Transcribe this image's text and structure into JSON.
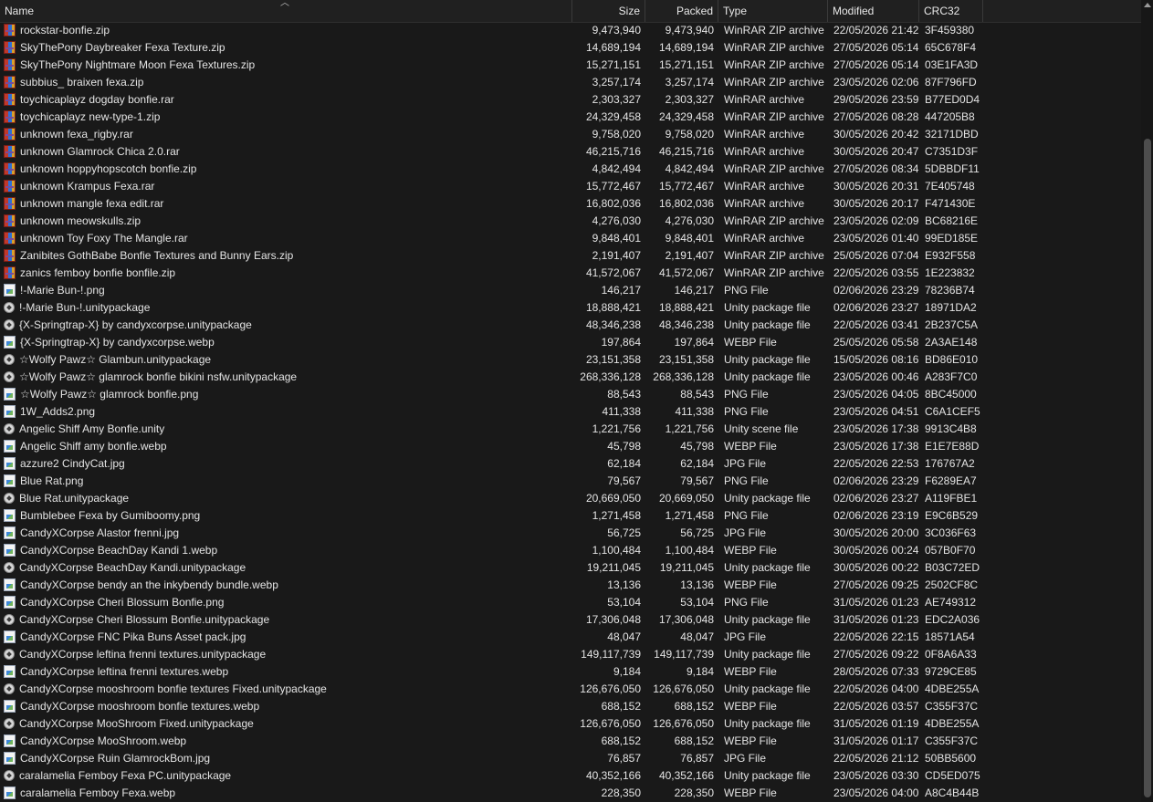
{
  "columns": {
    "name": "Name",
    "size": "Size",
    "packed": "Packed",
    "type": "Type",
    "modified": "Modified",
    "crc": "CRC32"
  },
  "rows": [
    {
      "icon": "archive",
      "name": "rockstar-bonfie.zip",
      "size": "9,473,940",
      "packed": "9,473,940",
      "type": "WinRAR ZIP archive",
      "modified": "22/05/2026 21:42",
      "crc": "3F459380"
    },
    {
      "icon": "archive",
      "name": "SkyThePony Daybreaker Fexa Texture.zip",
      "size": "14,689,194",
      "packed": "14,689,194",
      "type": "WinRAR ZIP archive",
      "modified": "27/05/2026 05:14",
      "crc": "65C678F4"
    },
    {
      "icon": "archive",
      "name": "SkyThePony Nightmare Moon Fexa Textures.zip",
      "size": "15,271,151",
      "packed": "15,271,151",
      "type": "WinRAR ZIP archive",
      "modified": "27/05/2026 05:14",
      "crc": "03E1FA3D"
    },
    {
      "icon": "archive",
      "name": "subbius_ braixen fexa.zip",
      "size": "3,257,174",
      "packed": "3,257,174",
      "type": "WinRAR ZIP archive",
      "modified": "23/05/2026 02:06",
      "crc": "87F796FD"
    },
    {
      "icon": "archive",
      "name": "toychicaplayz dogday bonfie.rar",
      "size": "2,303,327",
      "packed": "2,303,327",
      "type": "WinRAR archive",
      "modified": "29/05/2026 23:59",
      "crc": "B77ED0D4"
    },
    {
      "icon": "archive",
      "name": "toychicaplayz new-type-1.zip",
      "size": "24,329,458",
      "packed": "24,329,458",
      "type": "WinRAR ZIP archive",
      "modified": "27/05/2026 08:28",
      "crc": "447205B8"
    },
    {
      "icon": "archive",
      "name": "unknown fexa_rigby.rar",
      "size": "9,758,020",
      "packed": "9,758,020",
      "type": "WinRAR archive",
      "modified": "30/05/2026 20:42",
      "crc": "32171DBD"
    },
    {
      "icon": "archive",
      "name": "unknown Glamrock Chica 2.0.rar",
      "size": "46,215,716",
      "packed": "46,215,716",
      "type": "WinRAR archive",
      "modified": "30/05/2026 20:47",
      "crc": "C7351D3F"
    },
    {
      "icon": "archive",
      "name": "unknown hoppyhopscotch bonfie.zip",
      "size": "4,842,494",
      "packed": "4,842,494",
      "type": "WinRAR ZIP archive",
      "modified": "27/05/2026 08:34",
      "crc": "5DBBDF11"
    },
    {
      "icon": "archive",
      "name": "unknown Krampus Fexa.rar",
      "size": "15,772,467",
      "packed": "15,772,467",
      "type": "WinRAR archive",
      "modified": "30/05/2026 20:31",
      "crc": "7E405748"
    },
    {
      "icon": "archive",
      "name": "unknown mangle fexa edit.rar",
      "size": "16,802,036",
      "packed": "16,802,036",
      "type": "WinRAR archive",
      "modified": "30/05/2026 20:17",
      "crc": "F471430E"
    },
    {
      "icon": "archive",
      "name": "unknown meowskulls.zip",
      "size": "4,276,030",
      "packed": "4,276,030",
      "type": "WinRAR ZIP archive",
      "modified": "23/05/2026 02:09",
      "crc": "BC68216E"
    },
    {
      "icon": "archive",
      "name": "unknown Toy Foxy The Mangle.rar",
      "size": "9,848,401",
      "packed": "9,848,401",
      "type": "WinRAR archive",
      "modified": "23/05/2026 01:40",
      "crc": "99ED185E"
    },
    {
      "icon": "archive",
      "name": "Zanibites GothBabe Bonfie Textures and Bunny Ears.zip",
      "size": "2,191,407",
      "packed": "2,191,407",
      "type": "WinRAR ZIP archive",
      "modified": "25/05/2026 07:04",
      "crc": "E932F558"
    },
    {
      "icon": "archive",
      "name": "zanics femboy bonfie bonfile.zip",
      "size": "41,572,067",
      "packed": "41,572,067",
      "type": "WinRAR ZIP archive",
      "modified": "22/05/2026 03:55",
      "crc": "1E223832"
    },
    {
      "icon": "image",
      "name": "!-Marie Bun-!.png",
      "size": "146,217",
      "packed": "146,217",
      "type": "PNG File",
      "modified": "02/06/2026 23:29",
      "crc": "78236B74"
    },
    {
      "icon": "unity",
      "name": "!-Marie Bun-!.unitypackage",
      "size": "18,888,421",
      "packed": "18,888,421",
      "type": "Unity package file",
      "modified": "02/06/2026 23:27",
      "crc": "18971DA2"
    },
    {
      "icon": "unity",
      "name": "{X-Springtrap-X} by candyxcorpse.unitypackage",
      "size": "48,346,238",
      "packed": "48,346,238",
      "type": "Unity package file",
      "modified": "22/05/2026 03:41",
      "crc": "2B237C5A"
    },
    {
      "icon": "image",
      "name": "{X-Springtrap-X} by candyxcorpse.webp",
      "size": "197,864",
      "packed": "197,864",
      "type": "WEBP File",
      "modified": "25/05/2026 05:58",
      "crc": "2A3AE148"
    },
    {
      "icon": "unity",
      "name": "☆Wolfy Pawz☆ Glambun.unitypackage",
      "size": "23,151,358",
      "packed": "23,151,358",
      "type": "Unity package file",
      "modified": "15/05/2026 08:16",
      "crc": "BD86E010"
    },
    {
      "icon": "unity",
      "name": "☆Wolfy Pawz☆ glamrock bonfie bikini nsfw.unitypackage",
      "size": "268,336,128",
      "packed": "268,336,128",
      "type": "Unity package file",
      "modified": "23/05/2026 00:46",
      "crc": "A283F7C0"
    },
    {
      "icon": "image",
      "name": "☆Wolfy Pawz☆ glamrock bonfie.png",
      "size": "88,543",
      "packed": "88,543",
      "type": "PNG File",
      "modified": "23/05/2026 04:05",
      "crc": "8BC45000"
    },
    {
      "icon": "image",
      "name": "1W_Adds2.png",
      "size": "411,338",
      "packed": "411,338",
      "type": "PNG File",
      "modified": "23/05/2026 04:51",
      "crc": "C6A1CEF5"
    },
    {
      "icon": "unity",
      "name": "Angelic Shiff Amy Bonfie.unity",
      "size": "1,221,756",
      "packed": "1,221,756",
      "type": "Unity scene file",
      "modified": "23/05/2026 17:38",
      "crc": "9913C4B8"
    },
    {
      "icon": "image",
      "name": "Angelic Shiff amy bonfie.webp",
      "size": "45,798",
      "packed": "45,798",
      "type": "WEBP File",
      "modified": "23/05/2026 17:38",
      "crc": "E1E7E88D"
    },
    {
      "icon": "image",
      "name": "azzure2 CindyCat.jpg",
      "size": "62,184",
      "packed": "62,184",
      "type": "JPG File",
      "modified": "22/05/2026 22:53",
      "crc": "176767A2"
    },
    {
      "icon": "image",
      "name": "Blue Rat.png",
      "size": "79,567",
      "packed": "79,567",
      "type": "PNG File",
      "modified": "02/06/2026 23:29",
      "crc": "F6289EA7"
    },
    {
      "icon": "unity",
      "name": "Blue Rat.unitypackage",
      "size": "20,669,050",
      "packed": "20,669,050",
      "type": "Unity package file",
      "modified": "02/06/2026 23:27",
      "crc": "A119FBE1"
    },
    {
      "icon": "image",
      "name": "Bumblebee Fexa by Gumiboomy.png",
      "size": "1,271,458",
      "packed": "1,271,458",
      "type": "PNG File",
      "modified": "02/06/2026 23:19",
      "crc": "E9C6B529"
    },
    {
      "icon": "image",
      "name": "CandyXCorpse Alastor frenni.jpg",
      "size": "56,725",
      "packed": "56,725",
      "type": "JPG File",
      "modified": "30/05/2026 20:00",
      "crc": "3C036F63"
    },
    {
      "icon": "image",
      "name": "CandyXCorpse BeachDay Kandi 1.webp",
      "size": "1,100,484",
      "packed": "1,100,484",
      "type": "WEBP File",
      "modified": "30/05/2026 00:24",
      "crc": "057B0F70"
    },
    {
      "icon": "unity",
      "name": "CandyXCorpse BeachDay Kandi.unitypackage",
      "size": "19,211,045",
      "packed": "19,211,045",
      "type": "Unity package file",
      "modified": "30/05/2026 00:22",
      "crc": "B03C72ED"
    },
    {
      "icon": "image",
      "name": "CandyXCorpse bendy an the inkybendy  bundle.webp",
      "size": "13,136",
      "packed": "13,136",
      "type": "WEBP File",
      "modified": "27/05/2026 09:25",
      "crc": "2502CF8C"
    },
    {
      "icon": "image",
      "name": "CandyXCorpse Cheri Blossum Bonfie.png",
      "size": "53,104",
      "packed": "53,104",
      "type": "PNG File",
      "modified": "31/05/2026 01:23",
      "crc": "AE749312"
    },
    {
      "icon": "unity",
      "name": "CandyXCorpse Cheri Blossum Bonfie.unitypackage",
      "size": "17,306,048",
      "packed": "17,306,048",
      "type": "Unity package file",
      "modified": "31/05/2026 01:23",
      "crc": "EDC2A036"
    },
    {
      "icon": "image",
      "name": "CandyXCorpse FNC Pika Buns Asset pack.jpg",
      "size": "48,047",
      "packed": "48,047",
      "type": "JPG File",
      "modified": "22/05/2026 22:15",
      "crc": "18571A54"
    },
    {
      "icon": "unity",
      "name": "CandyXCorpse leftina frenni textures.unitypackage",
      "size": "149,117,739",
      "packed": "149,117,739",
      "type": "Unity package file",
      "modified": "27/05/2026 09:22",
      "crc": "0F8A6A33"
    },
    {
      "icon": "image",
      "name": "CandyXCorpse leftina frenni textures.webp",
      "size": "9,184",
      "packed": "9,184",
      "type": "WEBP File",
      "modified": "28/05/2026 07:33",
      "crc": "9729CE85"
    },
    {
      "icon": "unity",
      "name": "CandyXCorpse mooshroom bonfie textures Fixed.unitypackage",
      "size": "126,676,050",
      "packed": "126,676,050",
      "type": "Unity package file",
      "modified": "22/05/2026 04:00",
      "crc": "4DBE255A"
    },
    {
      "icon": "image",
      "name": "CandyXCorpse mooshroom bonfie textures.webp",
      "size": "688,152",
      "packed": "688,152",
      "type": "WEBP File",
      "modified": "22/05/2026 03:57",
      "crc": "C355F37C"
    },
    {
      "icon": "unity",
      "name": "CandyXCorpse MooShroom Fixed.unitypackage",
      "size": "126,676,050",
      "packed": "126,676,050",
      "type": "Unity package file",
      "modified": "31/05/2026 01:19",
      "crc": "4DBE255A"
    },
    {
      "icon": "image",
      "name": "CandyXCorpse MooShroom.webp",
      "size": "688,152",
      "packed": "688,152",
      "type": "WEBP File",
      "modified": "31/05/2026 01:17",
      "crc": "C355F37C"
    },
    {
      "icon": "image",
      "name": "CandyXCorpse Ruin GlamrockBom.jpg",
      "size": "76,857",
      "packed": "76,857",
      "type": "JPG File",
      "modified": "22/05/2026 21:12",
      "crc": "50BB5600"
    },
    {
      "icon": "unity",
      "name": "caralamelia Femboy Fexa PC.unitypackage",
      "size": "40,352,166",
      "packed": "40,352,166",
      "type": "Unity package file",
      "modified": "23/05/2026 03:30",
      "crc": "CD5ED075"
    },
    {
      "icon": "image",
      "name": "caralamelia Femboy Fexa.webp",
      "size": "228,350",
      "packed": "228,350",
      "type": "WEBP File",
      "modified": "23/05/2026 04:00",
      "crc": "A8C4B44B"
    }
  ]
}
